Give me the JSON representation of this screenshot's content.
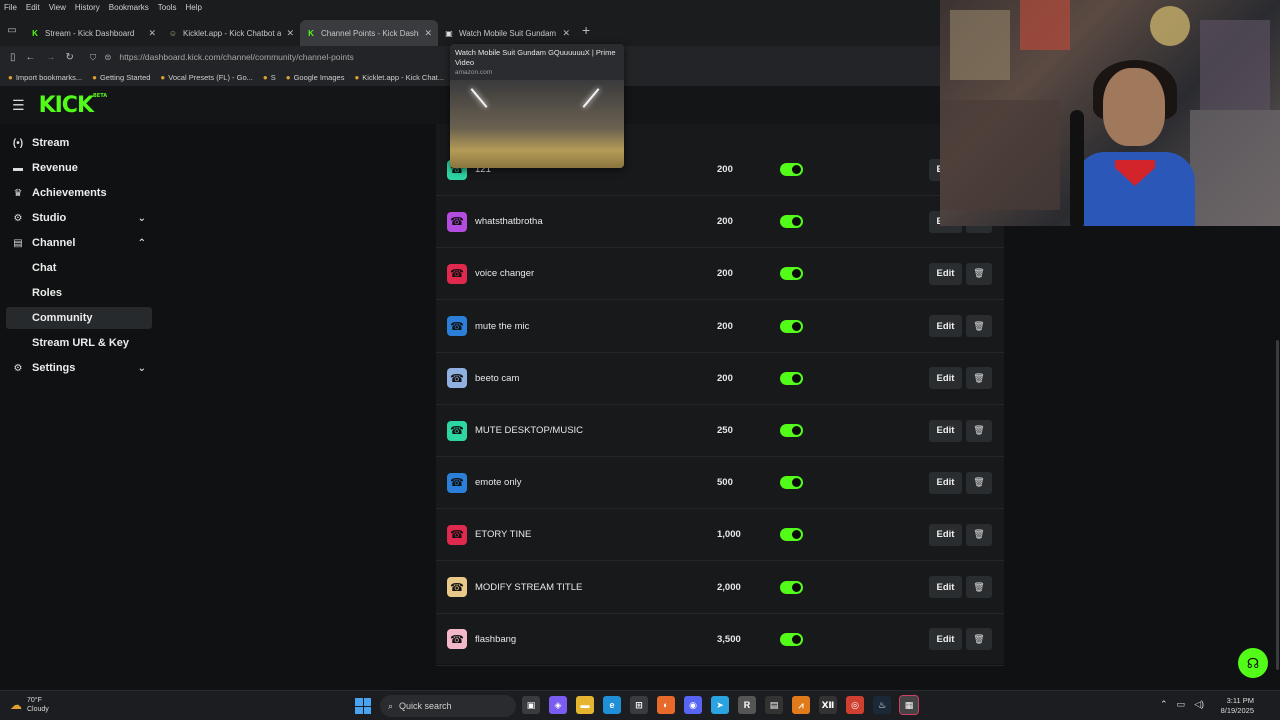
{
  "browser": {
    "menu": [
      "File",
      "Edit",
      "View",
      "History",
      "Bookmarks",
      "Tools",
      "Help"
    ],
    "tabs": [
      {
        "title": "Stream - Kick Dashboard",
        "fav": "K",
        "fav_color": "#53fc18",
        "active": false
      },
      {
        "title": "Kicklet.app - Kick Chatbot and C",
        "fav": "☺",
        "fav_color": "#9fb86a",
        "active": false
      },
      {
        "title": "Channel Points - Kick Dashboard",
        "fav": "K",
        "fav_color": "#53fc18",
        "active": true
      },
      {
        "title": "Watch Mobile Suit Gundam G",
        "fav": "▣",
        "fav_color": "#dddddd",
        "active": false
      }
    ],
    "url": "https://dashboard.kick.com/channel/community/channel-points",
    "bookmarks": [
      {
        "label": "Import bookmarks...",
        "icon": "import-icon"
      },
      {
        "label": "Getting Started",
        "icon": "firefox-icon"
      },
      {
        "label": "Vocal Presets (FL) - Go...",
        "icon": "globe-icon"
      },
      {
        "label": "S",
        "icon": "s-icon"
      },
      {
        "label": "Google Images",
        "icon": "google-icon"
      },
      {
        "label": "Kicklet.app - Kick Chat...",
        "icon": "kicklet-icon"
      }
    ],
    "tooltip": {
      "title": "Watch Mobile Suit Gundam GQuuuuuuX | Prime Video",
      "domain": "amazon.com"
    }
  },
  "app": {
    "logo": "KICK",
    "logo_badge": "BETA",
    "accent": "#53fc18"
  },
  "sidebar": {
    "items": [
      {
        "label": "Stream",
        "icon": "stream-icon",
        "glyph": "(•)",
        "chev": "",
        "sub": false,
        "selected": false
      },
      {
        "label": "Revenue",
        "icon": "revenue-icon",
        "glyph": "▬",
        "chev": "",
        "sub": false,
        "selected": false
      },
      {
        "label": "Achievements",
        "icon": "trophy-icon",
        "glyph": "♛",
        "chev": "",
        "sub": false,
        "selected": false
      },
      {
        "label": "Studio",
        "icon": "studio-icon",
        "glyph": "⚙",
        "chev": "⌄",
        "sub": false,
        "selected": false
      },
      {
        "label": "Channel",
        "icon": "channel-icon",
        "glyph": "▤",
        "chev": "⌃",
        "sub": false,
        "selected": false
      },
      {
        "label": "Chat",
        "icon": "",
        "glyph": "",
        "chev": "",
        "sub": true,
        "selected": false
      },
      {
        "label": "Roles",
        "icon": "",
        "glyph": "",
        "chev": "",
        "sub": true,
        "selected": false
      },
      {
        "label": "Community",
        "icon": "",
        "glyph": "",
        "chev": "",
        "sub": true,
        "selected": true
      },
      {
        "label": "Stream URL & Key",
        "icon": "",
        "glyph": "",
        "chev": "",
        "sub": true,
        "selected": false
      },
      {
        "label": "Settings",
        "icon": "settings-icon",
        "glyph": "⚙",
        "chev": "⌄",
        "sub": false,
        "selected": false
      }
    ]
  },
  "rewards": {
    "edit_label": "Edit",
    "rows": [
      {
        "name": "121",
        "cost": "200",
        "color": "#2ed6a4",
        "enabled": true
      },
      {
        "name": "whatsthatbrotha",
        "cost": "200",
        "color": "#b34de0",
        "enabled": true
      },
      {
        "name": "voice changer",
        "cost": "200",
        "color": "#e0294f",
        "enabled": true
      },
      {
        "name": "mute the mic",
        "cost": "200",
        "color": "#2b7fd8",
        "enabled": true
      },
      {
        "name": "beeto cam",
        "cost": "200",
        "color": "#8fb0e0",
        "enabled": true
      },
      {
        "name": "MUTE DESKTOP/MUSIC",
        "cost": "250",
        "color": "#2ed6a4",
        "enabled": true
      },
      {
        "name": "emote only",
        "cost": "500",
        "color": "#2b7fd8",
        "enabled": true
      },
      {
        "name": "ETORY TINE",
        "cost": "1,000",
        "color": "#e0294f",
        "enabled": true
      },
      {
        "name": "MODIFY STREAM TITLE",
        "cost": "2,000",
        "color": "#e8c98a",
        "enabled": true
      },
      {
        "name": "flashbang",
        "cost": "3,500",
        "color": "#f2b8c8",
        "enabled": true
      }
    ]
  },
  "taskbar": {
    "temp": "70°F",
    "weather": "Cloudy",
    "search_placeholder": "Quick search",
    "time": "3:11 PM",
    "date": "8/19/2025"
  }
}
